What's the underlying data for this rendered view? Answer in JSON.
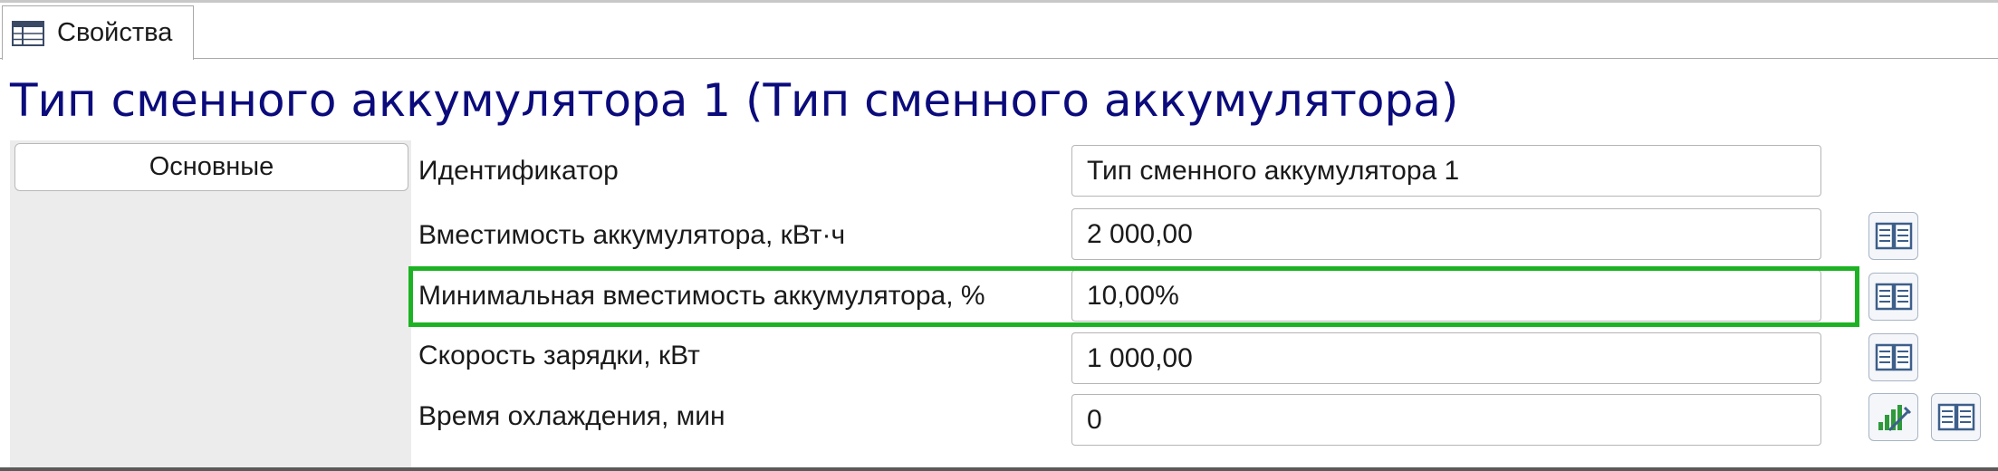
{
  "tabs": [
    {
      "label": "Свойства",
      "icon": "table-icon"
    }
  ],
  "page_title": "Тип сменного аккумулятора 1 (Тип сменного аккумулятора)",
  "sidebar": {
    "categories": [
      {
        "label": "Основные"
      }
    ]
  },
  "properties": [
    {
      "label": "Идентификатор",
      "value": "Тип сменного аккумулятора 1",
      "buttons": []
    },
    {
      "label": "Вместимость аккумулятора, кВт·ч",
      "value": "2 000,00",
      "buttons": [
        "book-icon"
      ]
    },
    {
      "label": "Минимальная вместимость аккумулятора, %",
      "value": "10,00%",
      "buttons": [
        "book-icon"
      ],
      "highlighted": true
    },
    {
      "label": "Скорость зарядки, кВт",
      "value": "1 000,00",
      "buttons": [
        "book-icon"
      ]
    },
    {
      "label": "Время охлаждения, мин",
      "value": "0",
      "buttons": [
        "chart-edit-icon",
        "book-icon"
      ]
    }
  ],
  "colors": {
    "title": "#0b0b7c",
    "highlight": "#1db224",
    "sidebar_bg": "#ececec"
  }
}
